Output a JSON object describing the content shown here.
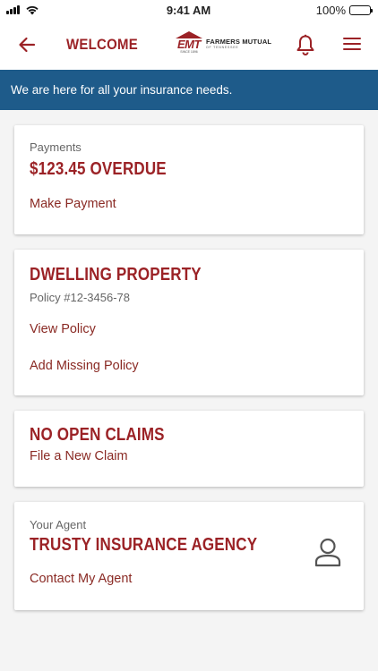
{
  "status_bar": {
    "time": "9:41 AM",
    "battery": "100%",
    "battery_level": 1.0,
    "icons": [
      "signal-icon",
      "wifi-icon",
      "battery-icon"
    ]
  },
  "header": {
    "title": "WELCOME",
    "logo": {
      "abbr": "EMT",
      "name": "FARMERS MUTUAL",
      "sub": "OF TENNESSEE",
      "since": "SINCE 1896"
    },
    "icons": [
      "back-arrow-icon",
      "bell-icon",
      "hamburger-menu-icon"
    ]
  },
  "banner": {
    "text": "We are here for all your insurance needs."
  },
  "cards": {
    "payments": {
      "label": "Payments",
      "amount": "$123.45 OVERDUE",
      "link": "Make Payment"
    },
    "dwelling": {
      "heading": "DWELLING PROPERTY",
      "policy": "Policy #12-3456-78",
      "view_link": "View Policy",
      "add_link": "Add Missing Policy"
    },
    "claims": {
      "heading": "NO OPEN CLAIMS",
      "link": "File a New Claim"
    },
    "agent": {
      "label": "Your Agent",
      "name": "TRUSTY INSURANCE AGENCY",
      "link": "Contact My Agent",
      "icon": "person-icon"
    }
  },
  "colors": {
    "brand_red": "#9b2226",
    "banner_blue": "#1e5b8a",
    "background": "#f4f4f4"
  }
}
